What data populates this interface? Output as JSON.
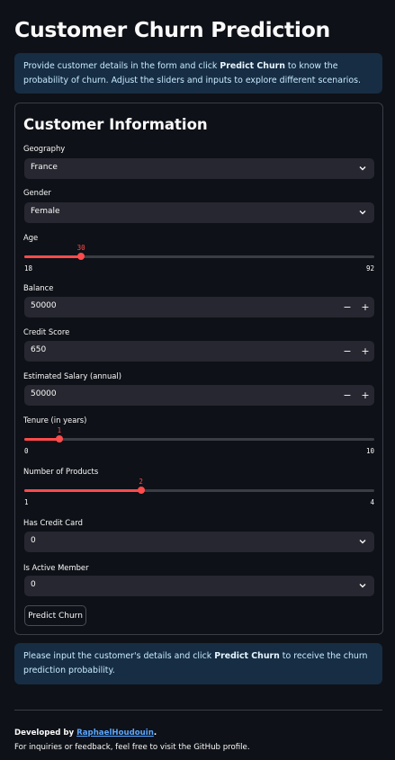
{
  "page": {
    "title": "Customer Churn Prediction",
    "intro": {
      "before": "Provide customer details in the form and click ",
      "bold": "Predict Churn",
      "after": " to know the probability of churn. Adjust the sliders and inputs to explore different scenarios."
    }
  },
  "form": {
    "title": "Customer Information",
    "geography": {
      "label": "Geography",
      "value": "France"
    },
    "gender": {
      "label": "Gender",
      "value": "Female"
    },
    "age": {
      "label": "Age",
      "value": 30,
      "min": 18,
      "max": 92
    },
    "balance": {
      "label": "Balance",
      "value": "50000"
    },
    "credit_score": {
      "label": "Credit Score",
      "value": "650"
    },
    "salary": {
      "label": "Estimated Salary (annual)",
      "value": "50000"
    },
    "tenure": {
      "label": "Tenure (in years)",
      "value": 1,
      "min": 0,
      "max": 10
    },
    "products": {
      "label": "Number of Products",
      "value": 2,
      "min": 1,
      "max": 4
    },
    "has_credit_card": {
      "label": "Has Credit Card",
      "value": "0"
    },
    "active_member": {
      "label": "Is Active Member",
      "value": "0"
    },
    "minus": "−",
    "plus": "+",
    "submit": "Predict Churn"
  },
  "result": {
    "before": "Please input the customer's details and click ",
    "bold": "Predict Churn",
    "after": " to receive the churn prediction probability."
  },
  "footer": {
    "dev_prefix": "Developed by ",
    "author": "RaphaelHoudouin",
    "dev_suffix": ".",
    "line2": "For inquiries or feedback, feel free to visit the GitHub profile."
  },
  "colors": {
    "accent": "#ff4b4b",
    "info_bg": "#172d43",
    "link": "#5aa7ff"
  },
  "icons": {
    "select_chevron": "chevron-down-icon"
  }
}
